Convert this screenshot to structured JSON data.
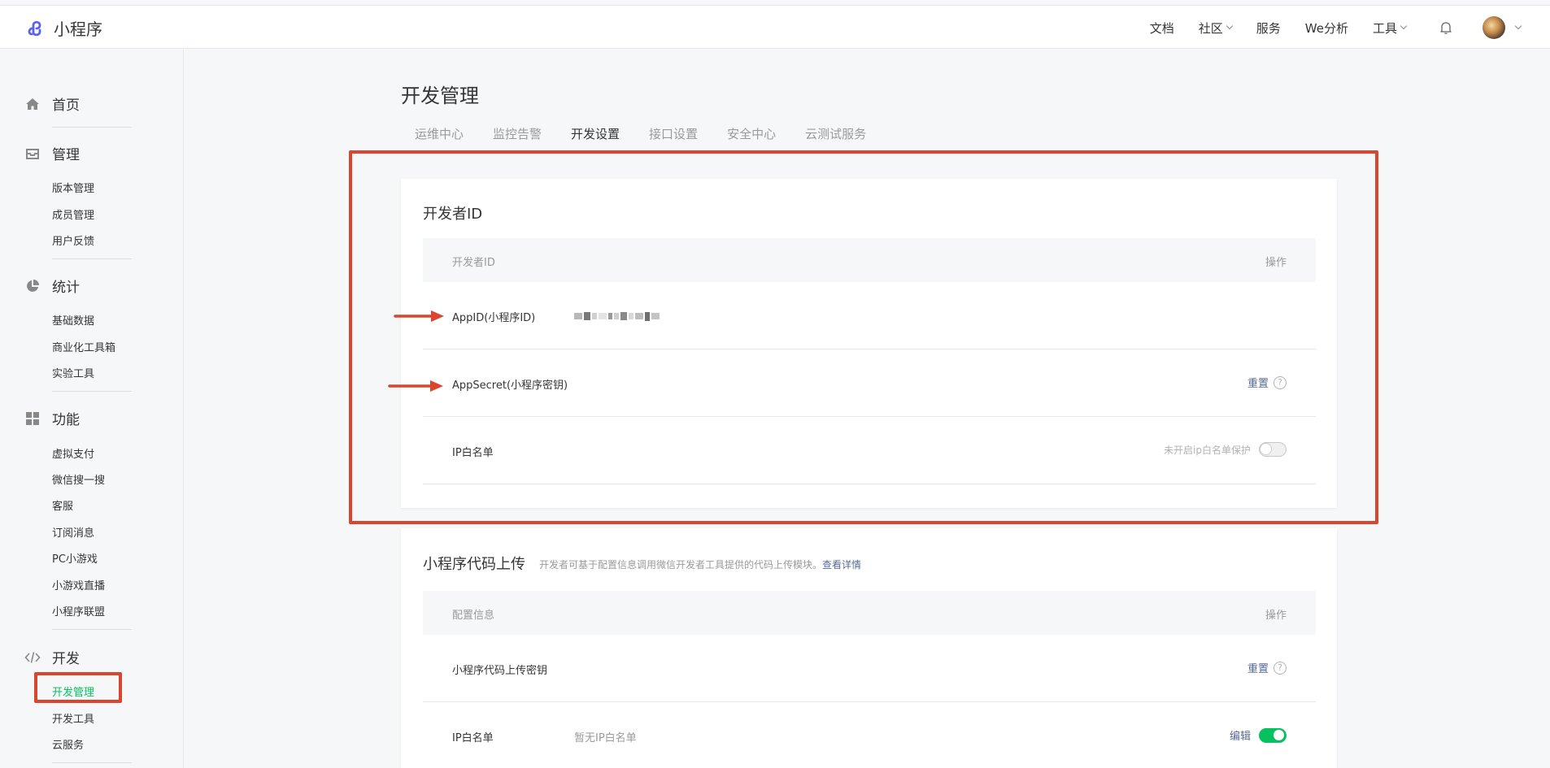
{
  "app": {
    "name": "小程序"
  },
  "topnav": {
    "items": [
      {
        "label": "文档",
        "dropdown": false
      },
      {
        "label": "社区",
        "dropdown": true
      },
      {
        "label": "服务",
        "dropdown": false
      },
      {
        "label": "We分析",
        "dropdown": false
      },
      {
        "label": "工具",
        "dropdown": true
      }
    ]
  },
  "sidebar": {
    "home": "首页",
    "manage": {
      "label": "管理",
      "items": [
        "版本管理",
        "成员管理",
        "用户反馈"
      ]
    },
    "stats": {
      "label": "统计",
      "items": [
        "基础数据",
        "商业化工具箱",
        "实验工具"
      ]
    },
    "features": {
      "label": "功能",
      "items": [
        "虚拟支付",
        "微信搜一搜",
        "客服",
        "订阅消息",
        "PC小游戏",
        "小游戏直播",
        "小程序联盟"
      ]
    },
    "dev": {
      "label": "开发",
      "items": [
        "开发管理",
        "开发工具",
        "云服务"
      ],
      "active": "开发管理"
    }
  },
  "page": {
    "title": "开发管理",
    "tabs": [
      "运维中心",
      "监控告警",
      "开发设置",
      "接口设置",
      "安全中心",
      "云测试服务"
    ],
    "active_tab": "开发设置"
  },
  "developer_id": {
    "title": "开发者ID",
    "header": {
      "col1": "开发者ID",
      "col2": "操作"
    },
    "rows": {
      "appid": {
        "key": "AppID(小程序ID)"
      },
      "appsecret": {
        "key": "AppSecret(小程序密钥)",
        "action": "重置",
        "help": "?"
      },
      "ip_whitelist": {
        "key": "IP白名单",
        "status": "未开启ip白名单保护",
        "toggle_on": false
      }
    }
  },
  "code_upload": {
    "title": "小程序代码上传",
    "description": "开发者可基于配置信息调用微信开发者工具提供的代码上传模块。",
    "description_link": "查看详情",
    "header": {
      "col1": "配置信息",
      "col2": "操作"
    },
    "rows": {
      "upload_key": {
        "key": "小程序代码上传密钥",
        "action": "重置",
        "help": "?"
      },
      "ip_whitelist": {
        "key": "IP白名单",
        "value": "暂无IP白名单",
        "action": "编辑",
        "toggle_on": true
      }
    }
  },
  "colors": {
    "accent_green": "#07c160",
    "link_blue": "#576b95",
    "annotation_red": "#d9452f"
  }
}
